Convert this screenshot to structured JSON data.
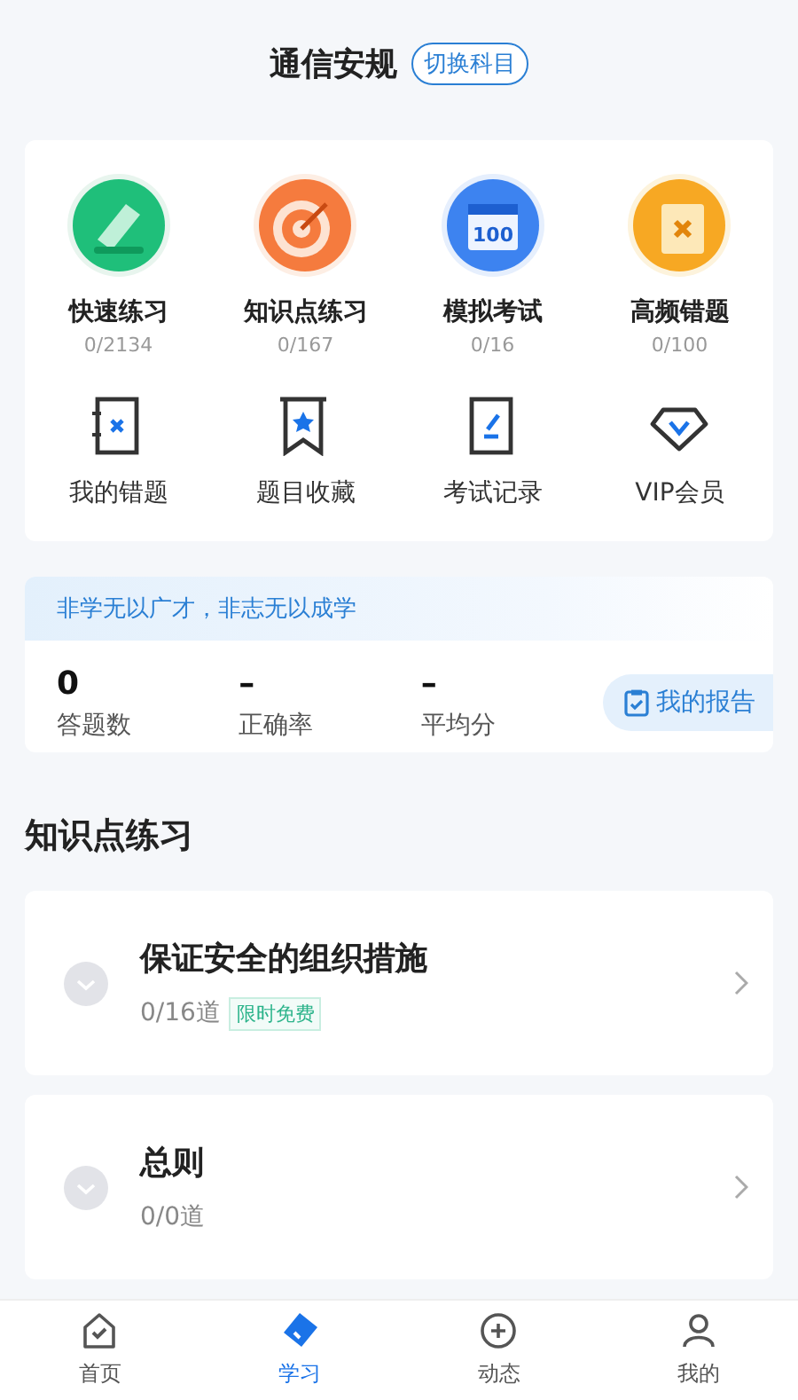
{
  "header": {
    "title": "通信安规",
    "switch_button": "切换科目"
  },
  "features": [
    {
      "kind": "quick",
      "label": "快速练习",
      "count": "0/2134"
    },
    {
      "kind": "knowledge",
      "label": "知识点练习",
      "count": "0/167"
    },
    {
      "kind": "mock",
      "label": "模拟考试",
      "count": "0/16",
      "icon_text": "100"
    },
    {
      "kind": "frequent",
      "label": "高频错题",
      "count": "0/100"
    }
  ],
  "tools": [
    {
      "kind": "wrong",
      "label": "我的错题"
    },
    {
      "kind": "favorite",
      "label": "题目收藏"
    },
    {
      "kind": "record",
      "label": "考试记录"
    },
    {
      "kind": "vip",
      "label": "VIP会员"
    }
  ],
  "stats": {
    "motto": "非学无以广才，非志无以成学",
    "items": [
      {
        "value": "0",
        "label": "答题数"
      },
      {
        "value": "–",
        "label": "正确率"
      },
      {
        "value": "–",
        "label": "平均分"
      }
    ],
    "report_button": "我的报告"
  },
  "section_title": "知识点练习",
  "topics": [
    {
      "title": "保证安全的组织措施",
      "progress": "0/16道",
      "badge": "限时免费"
    },
    {
      "title": "总则",
      "progress": "0/0道"
    }
  ],
  "bottom_nav": [
    {
      "kind": "home",
      "label": "首页",
      "selected": false
    },
    {
      "kind": "study",
      "label": "学习",
      "selected": true
    },
    {
      "kind": "feed",
      "label": "动态",
      "selected": false
    },
    {
      "kind": "me",
      "label": "我的",
      "selected": false
    }
  ]
}
